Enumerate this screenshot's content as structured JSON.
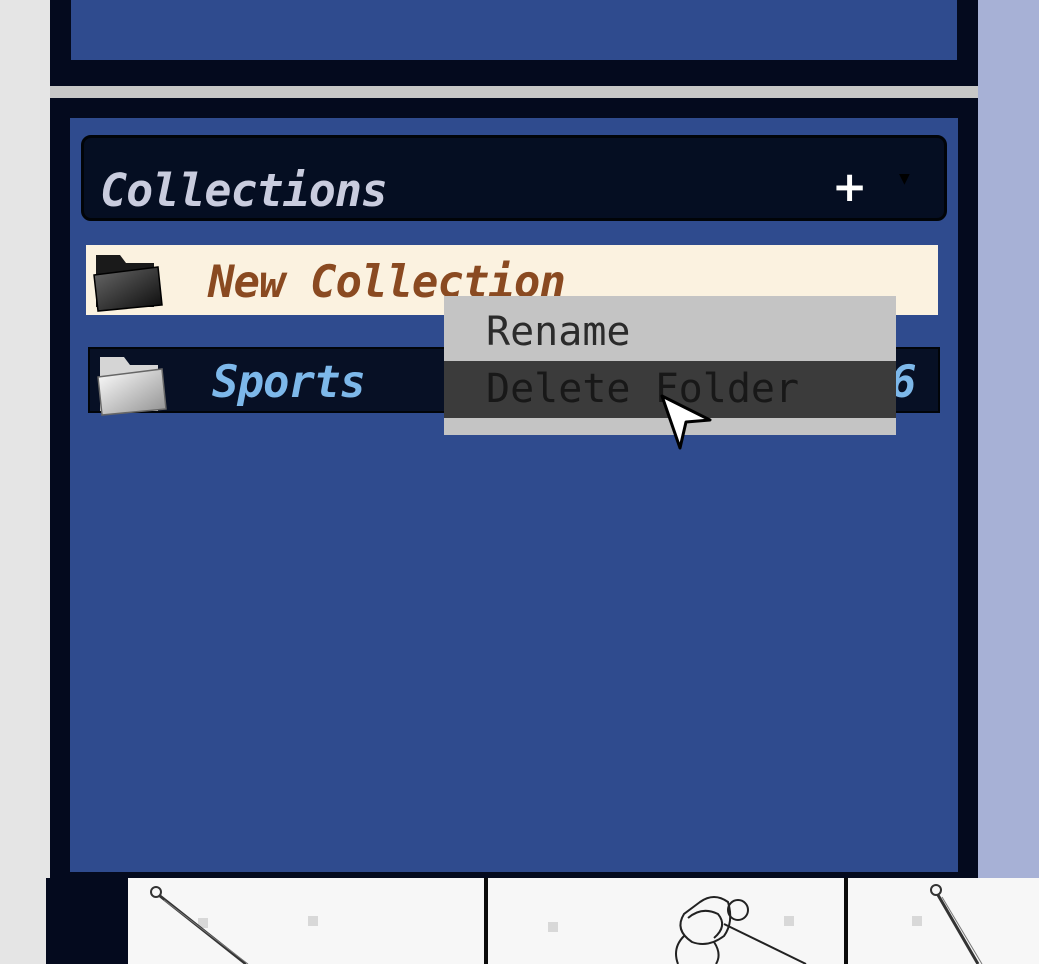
{
  "collections": {
    "header_title": "Collections",
    "add_label": "+",
    "dropdown_icon": "▼",
    "items": [
      {
        "label": "New Collection",
        "count": "",
        "state": "selected",
        "icon": "folder-dark-icon"
      },
      {
        "label": "Sports",
        "count": "6",
        "icon": "folder-light-icon"
      }
    ]
  },
  "context_menu": {
    "items": [
      {
        "label": "Rename"
      },
      {
        "label": "Delete Folder",
        "highlighted": true
      }
    ]
  },
  "colors": {
    "panel_blue": "#2f4b8e",
    "panel_dark": "#040a1e",
    "selected_bg": "#fbf2e0",
    "selected_text": "#8a4a21",
    "item_text": "#7db8ea",
    "menu_bg": "#c4c4c4",
    "menu_highlight": "#3b3b3b"
  },
  "thumbnails": [
    {
      "icon": "golf-club-image"
    },
    {
      "icon": "golfer-image"
    },
    {
      "icon": "golf-club-image"
    }
  ]
}
